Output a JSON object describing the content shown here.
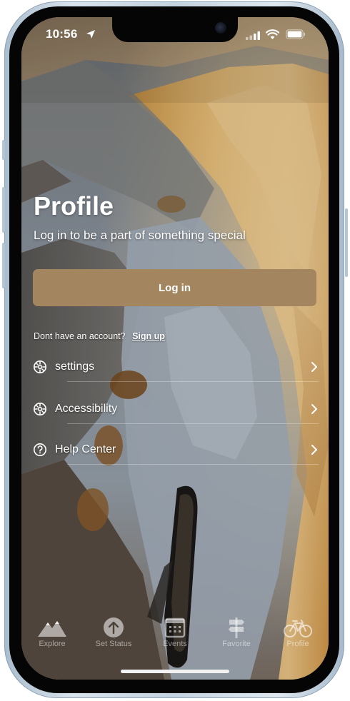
{
  "status_bar": {
    "time": "10:56"
  },
  "profile": {
    "title": "Profile",
    "subtitle": "Log in to be a part of something special",
    "login_label": "Log in",
    "no_account_text": "Dont have an account?",
    "signup_label": "Sign up"
  },
  "menu": [
    {
      "label": "settings",
      "icon": "gear-icon"
    },
    {
      "label": "Accessibility",
      "icon": "gear-icon"
    },
    {
      "label": "Help Center",
      "icon": "question-circle-icon"
    }
  ],
  "tabs": [
    {
      "label": "Explore",
      "icon": "mountains-icon"
    },
    {
      "label": "Set Status",
      "icon": "upload-icon"
    },
    {
      "label": "Events",
      "icon": "calendar-icon"
    },
    {
      "label": "Favorite",
      "icon": "signpost-icon"
    },
    {
      "label": "Profile",
      "icon": "bicycle-icon",
      "active": true
    }
  ],
  "colors": {
    "accent": "#a3855f",
    "text": "#ffffff"
  }
}
